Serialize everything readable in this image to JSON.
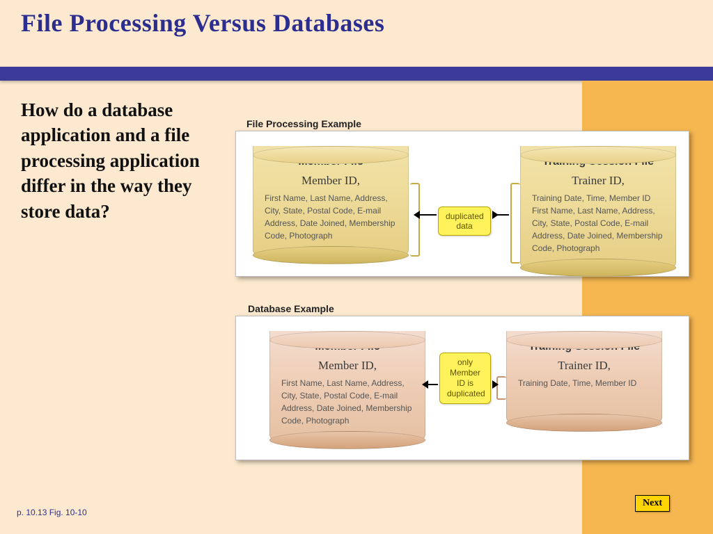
{
  "title": "File Processing Versus Databases",
  "body_question": "How do a database application and a file processing application differ in the way they store data?",
  "panel1": {
    "label": "File Processing Example",
    "left": {
      "title": "Member File",
      "key": "Member ID,",
      "fields": "First Name, Last Name, Address, City, State, Postal Code, E-mail Address, Date Joined, Membership Code, Photograph"
    },
    "right": {
      "title": "Training Session File",
      "key": "Trainer ID,",
      "fields": "Training Date, Time, Member ID First Name, Last Name, Address, City, State, Postal Code, E-mail Address, Date Joined, Membership Code, Photograph"
    },
    "callout": "duplicated data"
  },
  "panel2": {
    "label": "Database Example",
    "left": {
      "title": "Member File",
      "key": "Member ID,",
      "fields": "First Name, Last Name, Address, City, State, Postal Code, E-mail Address, Date Joined, Membership Code, Photograph"
    },
    "right": {
      "title": "Training Session File",
      "key": "Trainer ID,",
      "fields": "Training Date, Time, Member ID"
    },
    "callout": "only Member ID is duplicated"
  },
  "footer": "p. 10.13 Fig. 10-10",
  "next": "Next"
}
